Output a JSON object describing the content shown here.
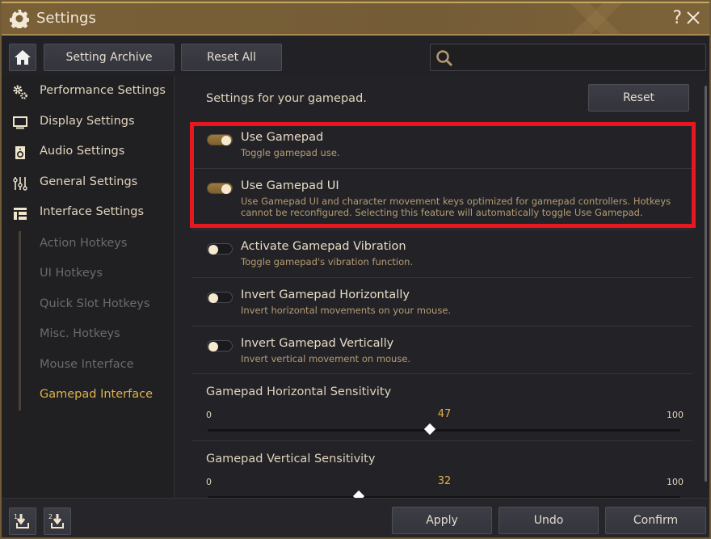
{
  "window": {
    "title": "Settings",
    "help_label": "?",
    "title_icon": "gear-icon",
    "close_icon": "close-icon"
  },
  "toolbar": {
    "home_icon": "home-icon",
    "archive_label": "Setting Archive",
    "reset_all_label": "Reset All",
    "search_placeholder": "",
    "search_value": ""
  },
  "sidebar": {
    "items": [
      {
        "label": "Performance Settings",
        "icon": "gears-icon"
      },
      {
        "label": "Display Settings",
        "icon": "monitor-icon"
      },
      {
        "label": "Audio Settings",
        "icon": "speaker-icon"
      },
      {
        "label": "General Settings",
        "icon": "sliders-icon"
      },
      {
        "label": "Interface Settings",
        "icon": "layout-icon"
      }
    ],
    "sub_items": [
      {
        "label": "Action Hotkeys",
        "active": false
      },
      {
        "label": "UI Hotkeys",
        "active": false
      },
      {
        "label": "Quick Slot Hotkeys",
        "active": false
      },
      {
        "label": "Misc. Hotkeys",
        "active": false
      },
      {
        "label": "Mouse Interface",
        "active": false
      },
      {
        "label": "Gamepad Interface",
        "active": true
      }
    ]
  },
  "content": {
    "header": "Settings for your gamepad.",
    "reset_label": "Reset",
    "toggles": [
      {
        "title": "Use Gamepad",
        "desc": "Toggle gamepad use.",
        "on": true
      },
      {
        "title": "Use Gamepad UI",
        "desc": "Use Gamepad UI and character movement keys optimized for gamepad controllers. Hotkeys cannot be reconfigured. Selecting this feature will automatically toggle Use Gamepad.",
        "on": true
      },
      {
        "title": "Activate Gamepad Vibration",
        "desc": "Toggle gamepad's vibration function.",
        "on": false
      },
      {
        "title": "Invert Gamepad Horizontally",
        "desc": "Invert horizontal movements on your mouse.",
        "on": false
      },
      {
        "title": "Invert Gamepad Vertically",
        "desc": "Invert vertical movement on mouse.",
        "on": false
      }
    ],
    "sliders": [
      {
        "label": "Gamepad Horizontal Sensitivity",
        "min": "0",
        "max": "100",
        "value": "47"
      },
      {
        "label": "Gamepad Vertical Sensitivity",
        "min": "0",
        "max": "100",
        "value": "32"
      }
    ]
  },
  "footer": {
    "download1_icon": "download-slot-1-icon",
    "download2_icon": "download-slot-2-icon",
    "download1_num": "1",
    "download2_num": "2",
    "apply_label": "Apply",
    "undo_label": "Undo",
    "confirm_label": "Confirm"
  },
  "colors": {
    "accent": "#e0b14a",
    "highlight": "#e8161f",
    "titlebar": "#7a6037"
  }
}
